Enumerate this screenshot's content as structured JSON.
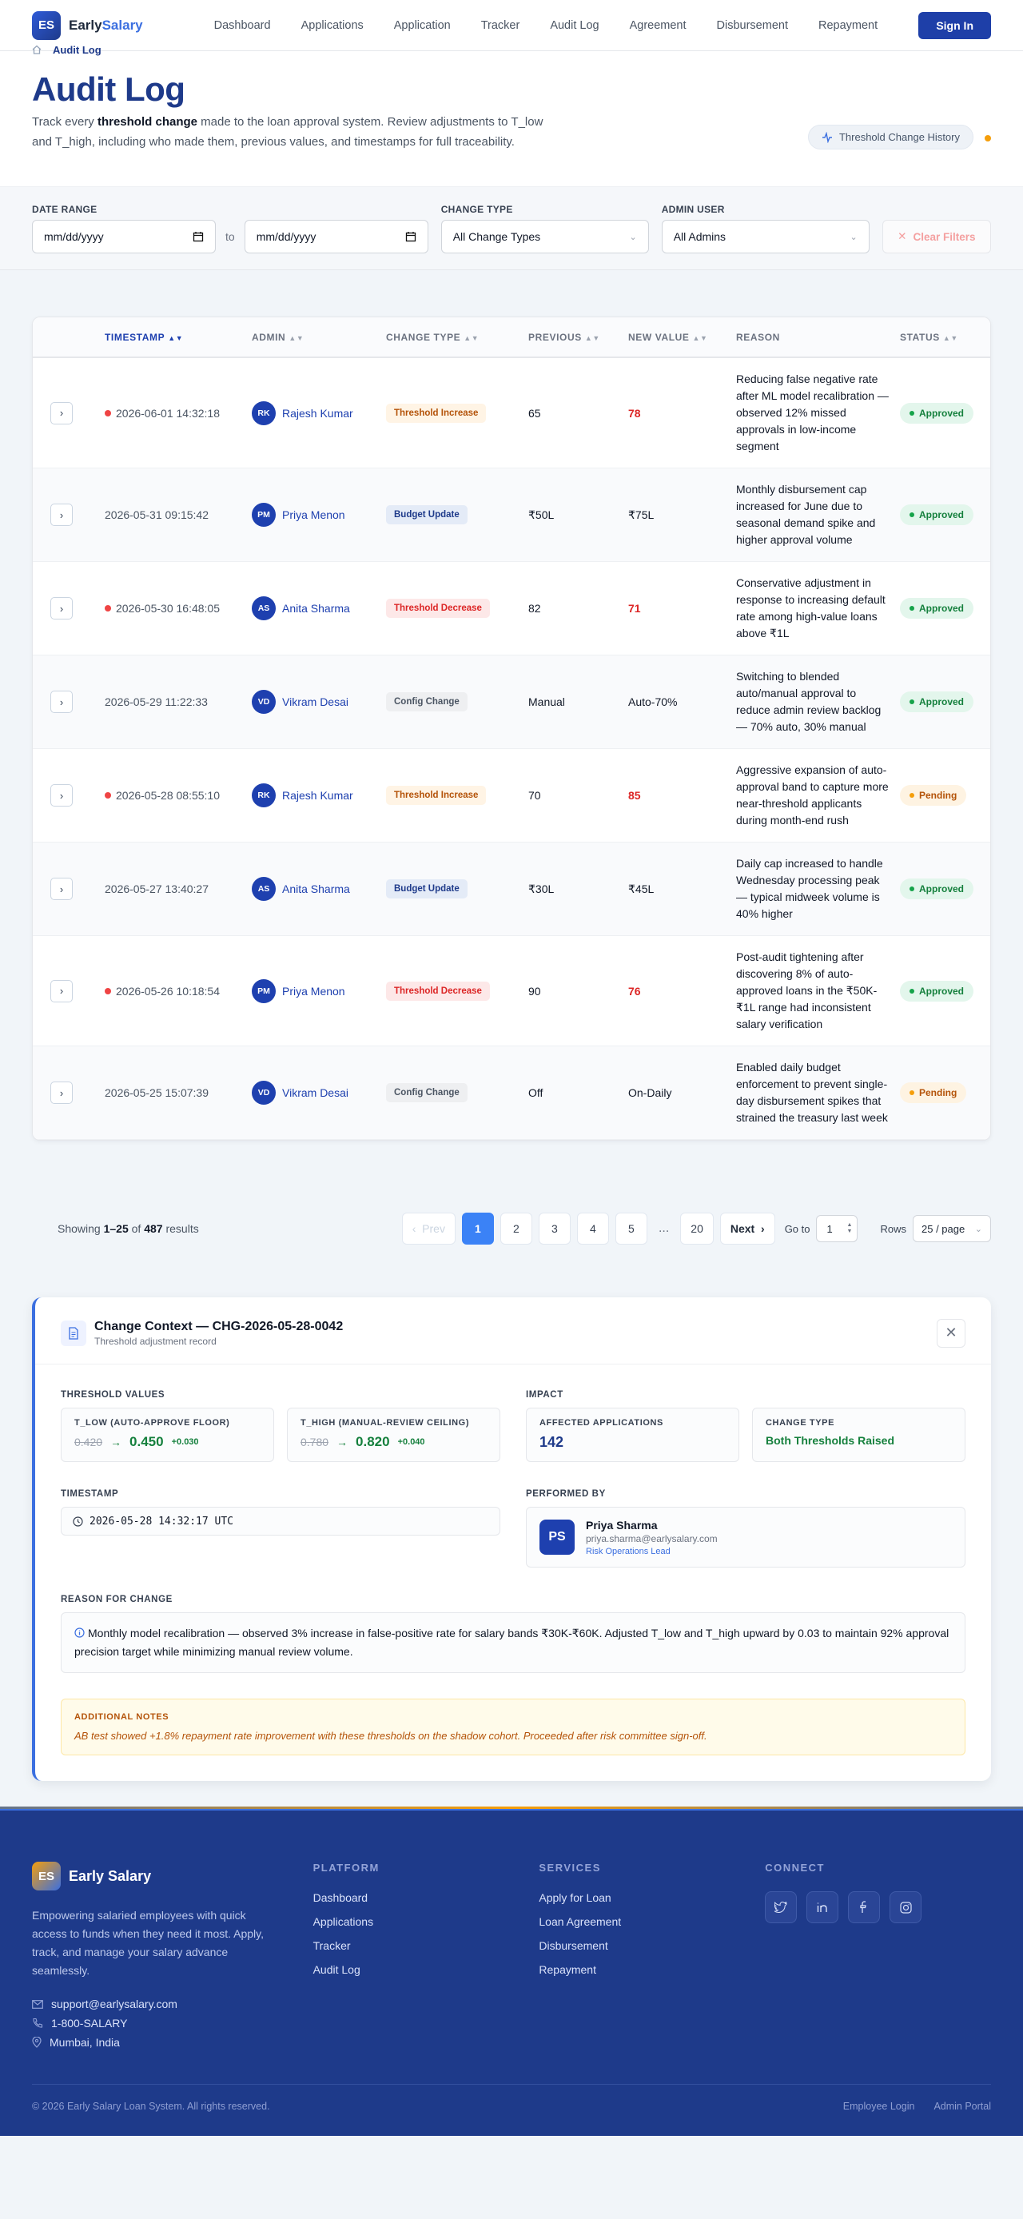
{
  "nav": {
    "logo_initials": "ES",
    "brand_first": "Early",
    "brand_second": "Salary",
    "links": [
      "Dashboard",
      "Applications",
      "Application",
      "Tracker",
      "Audit Log",
      "Agreement",
      "Disbursement",
      "Repayment"
    ],
    "signin": "Sign In"
  },
  "header": {
    "breadcrumb_current": "Audit Log",
    "title": "Audit Log",
    "desc_before": "Track every ",
    "desc_bold": "threshold change",
    "desc_after": " made to the loan approval system. Review adjustments to T_low and T_high, including who made them, previous values, and timestamps for full traceability.",
    "history_button": "Threshold Change History"
  },
  "filters": {
    "date_range_label": "DATE RANGE",
    "date_from": "mm/dd/yyyy",
    "date_to": "mm/dd/yyyy",
    "to_label": "to",
    "change_type_label": "CHANGE TYPE",
    "change_type_value": "All Change Types",
    "admin_label": "ADMIN USER",
    "admin_value": "All Admins",
    "clear": "Clear Filters"
  },
  "table": {
    "columns": [
      "TIMESTAMP",
      "ADMIN",
      "CHANGE TYPE",
      "PREVIOUS",
      "NEW VALUE",
      "REASON",
      "STATUS"
    ],
    "rows": [
      {
        "timestamp": "2026-06-01 14:32:18",
        "flag": true,
        "initials": "RK",
        "admin": "Rajesh Kumar",
        "type": "Threshold Increase",
        "kind": "inc",
        "previous": "65",
        "new": "78",
        "new_red": true,
        "reason": "Reducing false negative rate after ML model recalibration — observed 12% missed approvals in low-income segment",
        "status": "Approved"
      },
      {
        "timestamp": "2026-05-31 09:15:42",
        "flag": false,
        "initials": "PM",
        "admin": "Priya Menon",
        "type": "Budget Update",
        "kind": "bud",
        "previous": "₹50L",
        "new": "₹75L",
        "new_red": false,
        "reason": "Monthly disbursement cap increased for June due to seasonal demand spike and higher approval volume",
        "status": "Approved"
      },
      {
        "timestamp": "2026-05-30 16:48:05",
        "flag": true,
        "initials": "AS",
        "admin": "Anita Sharma",
        "type": "Threshold Decrease",
        "kind": "dec",
        "previous": "82",
        "new": "71",
        "new_red": true,
        "reason": "Conservative adjustment in response to increasing default rate among high-value loans above ₹1L",
        "status": "Approved"
      },
      {
        "timestamp": "2026-05-29 11:22:33",
        "flag": false,
        "initials": "VD",
        "admin": "Vikram Desai",
        "type": "Config Change",
        "kind": "cfg",
        "previous": "Manual",
        "new": "Auto-70%",
        "new_red": false,
        "reason": "Switching to blended auto/manual approval to reduce admin review backlog — 70% auto, 30% manual",
        "status": "Approved"
      },
      {
        "timestamp": "2026-05-28 08:55:10",
        "flag": true,
        "initials": "RK",
        "admin": "Rajesh Kumar",
        "type": "Threshold Increase",
        "kind": "inc",
        "previous": "70",
        "new": "85",
        "new_red": true,
        "reason": "Aggressive expansion of auto-approval band to capture more near-threshold applicants during month-end rush",
        "status": "Pending"
      },
      {
        "timestamp": "2026-05-27 13:40:27",
        "flag": false,
        "initials": "AS",
        "admin": "Anita Sharma",
        "type": "Budget Update",
        "kind": "bud",
        "previous": "₹30L",
        "new": "₹45L",
        "new_red": false,
        "reason": "Daily cap increased to handle Wednesday processing peak — typical midweek volume is 40% higher",
        "status": "Approved"
      },
      {
        "timestamp": "2026-05-26 10:18:54",
        "flag": true,
        "initials": "PM",
        "admin": "Priya Menon",
        "type": "Threshold Decrease",
        "kind": "dec",
        "previous": "90",
        "new": "76",
        "new_red": true,
        "reason": "Post-audit tightening after discovering 8% of auto-approved loans in the ₹50K-₹1L range had inconsistent salary verification",
        "status": "Approved"
      },
      {
        "timestamp": "2026-05-25 15:07:39",
        "flag": false,
        "initials": "VD",
        "admin": "Vikram Desai",
        "type": "Config Change",
        "kind": "cfg",
        "previous": "Off",
        "new": "On-Daily",
        "new_red": false,
        "reason": "Enabled daily budget enforcement to prevent single-day disbursement spikes that strained the treasury last week",
        "status": "Pending"
      }
    ]
  },
  "pagination": {
    "showing_prefix": "Showing ",
    "showing_range": "1–25",
    "showing_of": " of ",
    "showing_total": "487",
    "showing_suffix": " results",
    "prev": "Prev",
    "pages": [
      "1",
      "2",
      "3",
      "4",
      "5"
    ],
    "ellipsis": "...",
    "last": "20",
    "next": "Next",
    "goto_label": "Go to",
    "goto_value": "1",
    "rows_label": "Rows",
    "rows_value": "25 / page"
  },
  "detail": {
    "title": "Change Context — CHG-2026-05-28-0042",
    "subtitle": "Threshold adjustment record",
    "threshold_label": "THRESHOLD VALUES",
    "tlow_label": "T_LOW (AUTO-APPROVE FLOOR)",
    "tlow_old": "0.420",
    "tlow_new": "0.450",
    "tlow_delta": "+0.030",
    "thigh_label": "T_HIGH (MANUAL-REVIEW CEILING)",
    "thigh_old": "0.780",
    "thigh_new": "0.820",
    "thigh_delta": "+0.040",
    "arrow": "→",
    "impact_label": "IMPACT",
    "affected_label": "AFFECTED APPLICATIONS",
    "affected_value": "142",
    "change_type_label": "CHANGE TYPE",
    "change_type_value": "Both Thresholds Raised",
    "timestamp_label": "TIMESTAMP",
    "timestamp_value": "2026-05-28 14:32:17 UTC",
    "performed_label": "PERFORMED BY",
    "performer_initials": "PS",
    "performer_name": "Priya Sharma",
    "performer_email": "priya.sharma@earlysalary.com",
    "performer_role": "Risk Operations Lead",
    "reason_label": "REASON FOR CHANGE",
    "reason_text": "Monthly model recalibration — observed 3% increase in false-positive rate for salary bands ₹30K-₹60K. Adjusted T_low and T_high upward by 0.03 to maintain 92% approval precision target while minimizing manual review volume.",
    "notes_label": "ADDITIONAL NOTES",
    "notes_text": "AB test showed +1.8% repayment rate improvement with these thresholds on the shadow cohort. Proceeded after risk committee sign-off."
  },
  "footer": {
    "logo_initials": "ES",
    "brand": "Early Salary",
    "tagline": "Empowering salaried employees with quick access to funds when they need it most. Apply, track, and manage your salary advance seamlessly.",
    "email": "support@earlysalary.com",
    "phone": "1-800-SALARY",
    "location": "Mumbai, India",
    "platform_head": "PLATFORM",
    "platform_links": [
      "Dashboard",
      "Applications",
      "Tracker",
      "Audit Log"
    ],
    "services_head": "SERVICES",
    "services_links": [
      "Apply for Loan",
      "Loan Agreement",
      "Disbursement",
      "Repayment"
    ],
    "connect_head": "CONNECT",
    "copyright": "© 2026 Early Salary Loan System. All rights reserved.",
    "employee_login": "Employee Login",
    "admin_portal": "Admin Portal"
  },
  "colors": {
    "brand_primary": "#1e3a8a",
    "accent": "#3b6fe0",
    "danger": "#dc2626",
    "success": "#15803d",
    "warning": "#b45309"
  }
}
